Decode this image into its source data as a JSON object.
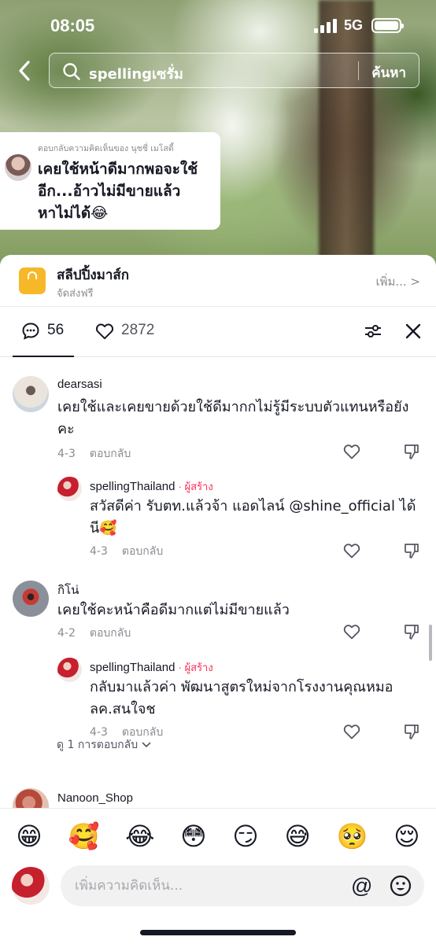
{
  "status_bar": {
    "time": "08:05",
    "network": "5G"
  },
  "search": {
    "query": "spellingเซรั่ม",
    "button_label": "ค้นหา"
  },
  "reply_bubble": {
    "caption": "ตอบกลับความคิดเห็นของ นุชชี่ เมโสตี้",
    "text": "เคยใช้หน้าดีมากพอจะใช้อีก...อ้าวไม่มีขายแล้ว หาไม่ได้😂"
  },
  "shop_banner": {
    "name": "สลีปปิ้งมาส์ก",
    "subtitle": "จัดส่งฟรี",
    "more_label": "เพิ่ม... >"
  },
  "tabs": {
    "comments_count": "56",
    "likes_count": "2872"
  },
  "comments": [
    {
      "user": "dearsasi",
      "text": "เคยใช้และเคยขายด้วยใช้ดีมากกไม่รู้มีระบบตัวแทนหรือยังคะ",
      "date": "4-3",
      "reply_label": "ตอบกลับ"
    },
    {
      "user": "spellingThailand",
      "creator_tag": "· ผู้สร้าง",
      "text": "สวัสดีค่า รับตท.แล้วจ้า แอดไลน์ @shine_official ได้นี🥰",
      "date": "4-3",
      "reply_label": "ตอบกลับ"
    },
    {
      "user": "กิโน่",
      "text": "เคยใช้คะหน้าคือดีมากแต่ไม่มีขายแล้ว",
      "date": "4-2",
      "reply_label": "ตอบกลับ"
    },
    {
      "user": "spellingThailand",
      "creator_tag": "· ผู้สร้าง",
      "text": "กลับมาแล้วค่า พัฒนาสูตรใหม่จากโรงงานคุณหมอ ลค.สนใจช",
      "date": "4-3",
      "reply_label": "ตอบกลับ"
    },
    {
      "user": "Nanoon_Shop"
    }
  ],
  "view_replies": "ดู 1 การตอบกลับ",
  "emoji_bar": [
    "😁",
    "🥰",
    "😂",
    "😳",
    "😏",
    "😅",
    "🥺",
    "😌"
  ],
  "input": {
    "placeholder": "เพิ่มความคิดเห็น...",
    "at_symbol": "@"
  }
}
